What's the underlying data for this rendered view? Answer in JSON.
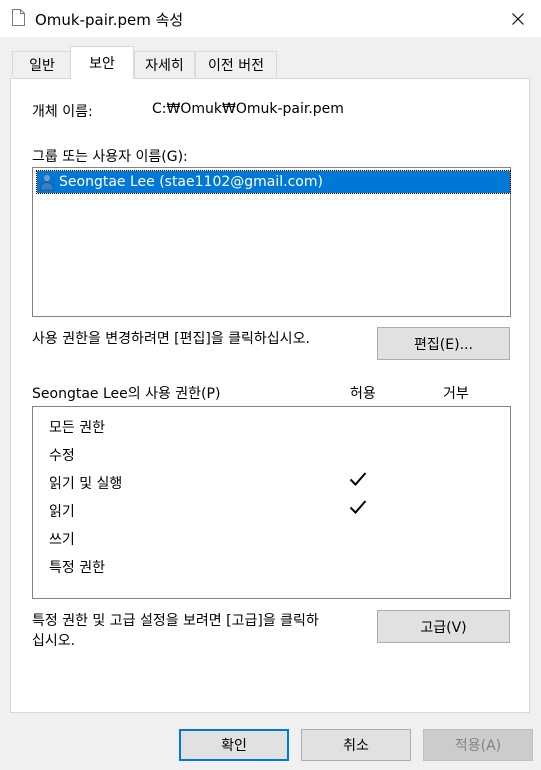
{
  "window": {
    "title": "Omuk-pair.pem 속성",
    "close_icon": "close-icon"
  },
  "tabs": [
    {
      "label": "일반",
      "active": false
    },
    {
      "label": "보안",
      "active": true
    },
    {
      "label": "자세히",
      "active": false
    },
    {
      "label": "이전 버전",
      "active": false
    }
  ],
  "security": {
    "object_name_label": "개체 이름:",
    "object_name_value": "C:₩Omuk₩Omuk-pair.pem",
    "groups_label": "그룹 또는 사용자 이름(G):",
    "users": [
      {
        "name": "Seongtae Lee (stae1102@gmail.com)",
        "selected": true
      }
    ],
    "edit_hint": "사용 권한을 변경하려면 [편집]을 클릭하십시오.",
    "edit_button": "편집(E)...",
    "perm_title": "Seongtae Lee의 사용 권한(P)",
    "allow_header": "허용",
    "deny_header": "거부",
    "permissions": [
      {
        "name": "모든 권한",
        "allow": false,
        "deny": false
      },
      {
        "name": "수정",
        "allow": false,
        "deny": false
      },
      {
        "name": "읽기 및 실행",
        "allow": true,
        "deny": false
      },
      {
        "name": "읽기",
        "allow": true,
        "deny": false
      },
      {
        "name": "쓰기",
        "allow": false,
        "deny": false
      },
      {
        "name": "특정 권한",
        "allow": false,
        "deny": false
      }
    ],
    "advanced_hint_line1": "특정 권한 및 고급 설정을 보려면 [고급]을 클릭하",
    "advanced_hint_line2": "십시오.",
    "advanced_button": "고급(V)"
  },
  "footer": {
    "ok": "확인",
    "cancel": "취소",
    "apply": "적용(A)"
  },
  "colors": {
    "selection": "#0078d7",
    "panel_bg": "#ffffff",
    "window_bg": "#f0f0f0"
  }
}
